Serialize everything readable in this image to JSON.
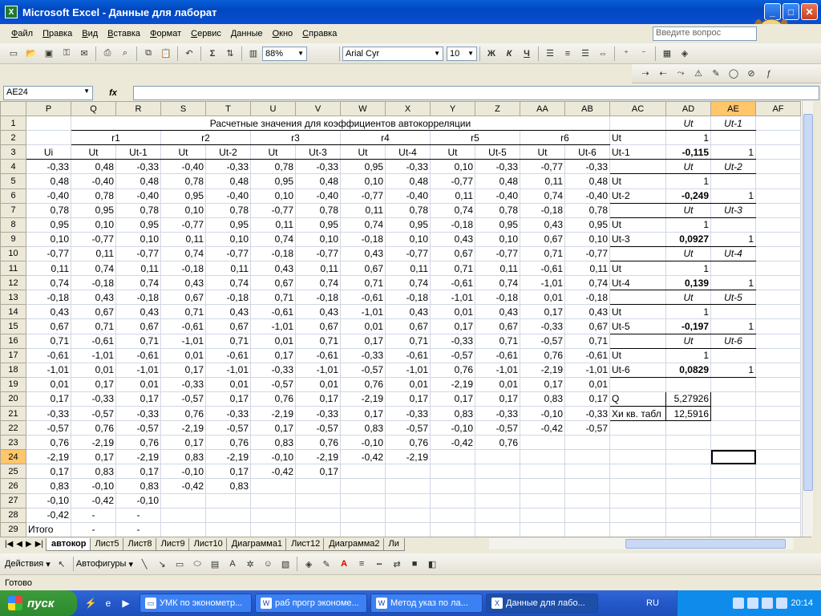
{
  "window": {
    "title": "Microsoft Excel - Данные для лаборат",
    "app_icon": "excel-icon"
  },
  "menu": [
    "Файл",
    "Правка",
    "Вид",
    "Вставка",
    "Формат",
    "Сервис",
    "Данные",
    "Окно",
    "Справка"
  ],
  "ask": {
    "placeholder": "Введите вопрос"
  },
  "toolbar": {
    "zoom": "88%",
    "font": "Arial Cyr",
    "size": "10",
    "bold": "Ж",
    "italic": "К",
    "underline": "Ч",
    "sum": "Σ"
  },
  "formula": {
    "namebox": "AE24",
    "fx": "fx",
    "value": ""
  },
  "columns": [
    "P",
    "Q",
    "R",
    "S",
    "T",
    "U",
    "V",
    "W",
    "X",
    "Y",
    "Z",
    "AA",
    "AB",
    "AC",
    "AD",
    "AE",
    "AF"
  ],
  "selected_column": "AE",
  "selected_row": 24,
  "title_row": "Расчетные значения для коэффициентов автокорреляции",
  "groups": [
    "r1",
    "r2",
    "r3",
    "r4",
    "r5",
    "r6"
  ],
  "header3": [
    "Ui",
    "Ut",
    "Ut-1",
    "Ut",
    "Ut-2",
    "Ut",
    "Ut-3",
    "Ut",
    "Ut-4",
    "Ut",
    "Ut-5",
    "Ut",
    "Ut-6"
  ],
  "data_rows": [
    [
      "-0,33",
      "0,48",
      "-0,33",
      "-0,40",
      "-0,33",
      "0,78",
      "-0,33",
      "0,95",
      "-0,33",
      "0,10",
      "-0,33",
      "-0,77",
      "-0,33"
    ],
    [
      "0,48",
      "-0,40",
      "0,48",
      "0,78",
      "0,48",
      "0,95",
      "0,48",
      "0,10",
      "0,48",
      "-0,77",
      "0,48",
      "0,11",
      "0,48"
    ],
    [
      "-0,40",
      "0,78",
      "-0,40",
      "0,95",
      "-0,40",
      "0,10",
      "-0,40",
      "-0,77",
      "-0,40",
      "0,11",
      "-0,40",
      "0,74",
      "-0,40"
    ],
    [
      "0,78",
      "0,95",
      "0,78",
      "0,10",
      "0,78",
      "-0,77",
      "0,78",
      "0,11",
      "0,78",
      "0,74",
      "0,78",
      "-0,18",
      "0,78"
    ],
    [
      "0,95",
      "0,10",
      "0,95",
      "-0,77",
      "0,95",
      "0,11",
      "0,95",
      "0,74",
      "0,95",
      "-0,18",
      "0,95",
      "0,43",
      "0,95"
    ],
    [
      "0,10",
      "-0,77",
      "0,10",
      "0,11",
      "0,10",
      "0,74",
      "0,10",
      "-0,18",
      "0,10",
      "0,43",
      "0,10",
      "0,67",
      "0,10"
    ],
    [
      "-0,77",
      "0,11",
      "-0,77",
      "0,74",
      "-0,77",
      "-0,18",
      "-0,77",
      "0,43",
      "-0,77",
      "0,67",
      "-0,77",
      "0,71",
      "-0,77"
    ],
    [
      "0,11",
      "0,74",
      "0,11",
      "-0,18",
      "0,11",
      "0,43",
      "0,11",
      "0,67",
      "0,11",
      "0,71",
      "0,11",
      "-0,61",
      "0,11"
    ],
    [
      "0,74",
      "-0,18",
      "0,74",
      "0,43",
      "0,74",
      "0,67",
      "0,74",
      "0,71",
      "0,74",
      "-0,61",
      "0,74",
      "-1,01",
      "0,74"
    ],
    [
      "-0,18",
      "0,43",
      "-0,18",
      "0,67",
      "-0,18",
      "0,71",
      "-0,18",
      "-0,61",
      "-0,18",
      "-1,01",
      "-0,18",
      "0,01",
      "-0,18"
    ],
    [
      "0,43",
      "0,67",
      "0,43",
      "0,71",
      "0,43",
      "-0,61",
      "0,43",
      "-1,01",
      "0,43",
      "0,01",
      "0,43",
      "0,17",
      "0,43"
    ],
    [
      "0,67",
      "0,71",
      "0,67",
      "-0,61",
      "0,67",
      "-1,01",
      "0,67",
      "0,01",
      "0,67",
      "0,17",
      "0,67",
      "-0,33",
      "0,67"
    ],
    [
      "0,71",
      "-0,61",
      "0,71",
      "-1,01",
      "0,71",
      "0,01",
      "0,71",
      "0,17",
      "0,71",
      "-0,33",
      "0,71",
      "-0,57",
      "0,71"
    ],
    [
      "-0,61",
      "-1,01",
      "-0,61",
      "0,01",
      "-0,61",
      "0,17",
      "-0,61",
      "-0,33",
      "-0,61",
      "-0,57",
      "-0,61",
      "0,76",
      "-0,61"
    ],
    [
      "-1,01",
      "0,01",
      "-1,01",
      "0,17",
      "-1,01",
      "-0,33",
      "-1,01",
      "-0,57",
      "-1,01",
      "0,76",
      "-1,01",
      "-2,19",
      "-1,01"
    ],
    [
      "0,01",
      "0,17",
      "0,01",
      "-0,33",
      "0,01",
      "-0,57",
      "0,01",
      "0,76",
      "0,01",
      "-2,19",
      "0,01",
      "0,17",
      "0,01"
    ],
    [
      "0,17",
      "-0,33",
      "0,17",
      "-0,57",
      "0,17",
      "0,76",
      "0,17",
      "-2,19",
      "0,17",
      "0,17",
      "0,17",
      "0,83",
      "0,17"
    ],
    [
      "-0,33",
      "-0,57",
      "-0,33",
      "0,76",
      "-0,33",
      "-2,19",
      "-0,33",
      "0,17",
      "-0,33",
      "0,83",
      "-0,33",
      "-0,10",
      "-0,33"
    ],
    [
      "-0,57",
      "0,76",
      "-0,57",
      "-2,19",
      "-0,57",
      "0,17",
      "-0,57",
      "0,83",
      "-0,57",
      "-0,10",
      "-0,57",
      "-0,42",
      "-0,57"
    ],
    [
      "0,76",
      "-2,19",
      "0,76",
      "0,17",
      "0,76",
      "0,83",
      "0,76",
      "-0,10",
      "0,76",
      "-0,42",
      "0,76",
      "",
      ""
    ],
    [
      "-2,19",
      "0,17",
      "-2,19",
      "0,83",
      "-2,19",
      "-0,10",
      "-2,19",
      "-0,42",
      "-2,19",
      "",
      "",
      "",
      ""
    ],
    [
      "0,17",
      "0,83",
      "0,17",
      "-0,10",
      "0,17",
      "-0,42",
      "0,17",
      "",
      "",
      "",
      "",
      "",
      ""
    ],
    [
      "0,83",
      "-0,10",
      "0,83",
      "-0,42",
      "0,83",
      "",
      "",
      "",
      "",
      "",
      "",
      "",
      ""
    ],
    [
      "-0,10",
      "-0,42",
      "-0,10",
      "",
      "",
      "",
      "",
      "",
      "",
      "",
      "",
      "",
      ""
    ],
    [
      "-0,42",
      "-",
      "-",
      "",
      "",
      "",
      "",
      "",
      "",
      "",
      "",
      "",
      ""
    ],
    [
      "Итого",
      "-",
      "-",
      "",
      "",
      "",
      "",
      "",
      "",
      "",
      "",
      "",
      ""
    ]
  ],
  "side": {
    "pairs": [
      {
        "h1": "Ut",
        "h2": "Ut-1",
        "lab1": "Ut",
        "v1": "1",
        "lab2": "Ut-1",
        "r": "-0,115",
        "v2": "1"
      },
      {
        "h1": "Ut",
        "h2": "Ut-2",
        "lab1": "Ut",
        "v1": "1",
        "lab2": "Ut-2",
        "r": "-0,249",
        "v2": "1"
      },
      {
        "h1": "Ut",
        "h2": "Ut-3",
        "lab1": "Ut",
        "v1": "1",
        "lab2": "Ut-3",
        "r": "0,0927",
        "v2": "1"
      },
      {
        "h1": "Ut",
        "h2": "Ut-4",
        "lab1": "Ut",
        "v1": "1",
        "lab2": "Ut-4",
        "r": "0,139",
        "v2": "1"
      },
      {
        "h1": "Ut",
        "h2": "Ut-5",
        "lab1": "Ut",
        "v1": "1",
        "lab2": "Ut-5",
        "r": "-0,197",
        "v2": "1"
      },
      {
        "h1": "Ut",
        "h2": "Ut-6",
        "lab1": "Ut",
        "v1": "1",
        "lab2": "Ut-6",
        "r": "0,0829",
        "v2": "1"
      }
    ],
    "q_label": "Q",
    "q_value": "5,27926",
    "chi_label": "Хи кв. табл",
    "chi_value": "12,5916"
  },
  "sheet_tabs": [
    "автокор",
    "Лист5",
    "Лист8",
    "Лист9",
    "Лист10",
    "Диаграмма1",
    "Лист12",
    "Диаграмма2",
    "Ли"
  ],
  "active_tab": "автокор",
  "drawbar": {
    "actions": "Действия",
    "autoshapes": "Автофигуры"
  },
  "status": "Готово",
  "taskbar": {
    "start": "пуск",
    "tasks": [
      "УМК по эконометр...",
      "раб прогр экономе...",
      "Метод указ по ла...",
      "Данные для лабо..."
    ],
    "lang": "RU",
    "time": "20:14"
  }
}
